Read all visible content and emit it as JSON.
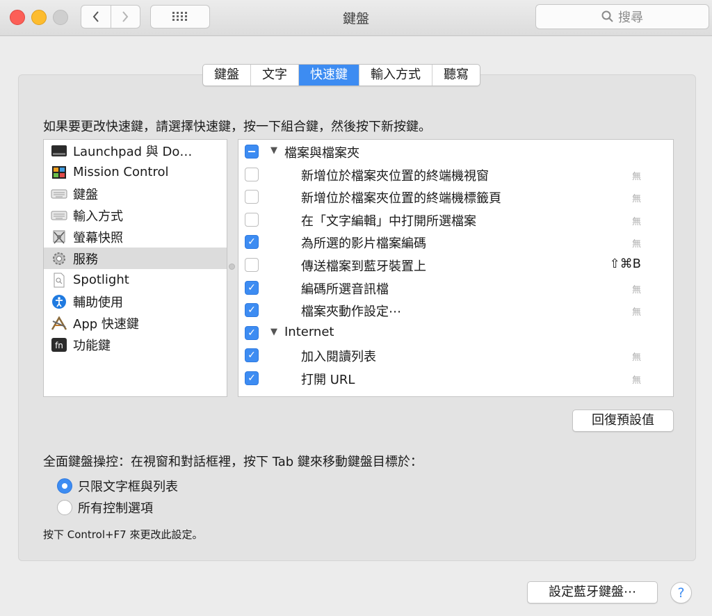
{
  "window": {
    "title": "鍵盤",
    "search_placeholder": "搜尋"
  },
  "tabs": [
    {
      "label": "鍵盤",
      "active": false
    },
    {
      "label": "文字",
      "active": false
    },
    {
      "label": "快速鍵",
      "active": true
    },
    {
      "label": "輸入方式",
      "active": false
    },
    {
      "label": "聽寫",
      "active": false
    }
  ],
  "instruction": "如果要更改快速鍵，請選擇快速鍵，按一下組合鍵，然後按下新按鍵。",
  "categories": [
    {
      "label": "Launchpad 與 Do…",
      "icon": "launchpad-icon",
      "selected": false
    },
    {
      "label": "Mission Control",
      "icon": "mission-control-icon",
      "selected": false
    },
    {
      "label": "鍵盤",
      "icon": "keyboard-icon",
      "selected": false
    },
    {
      "label": "輸入方式",
      "icon": "input-source-icon",
      "selected": false
    },
    {
      "label": "螢幕快照",
      "icon": "screenshot-icon",
      "selected": false
    },
    {
      "label": "服務",
      "icon": "services-gear-icon",
      "selected": true
    },
    {
      "label": "Spotlight",
      "icon": "spotlight-icon",
      "selected": false
    },
    {
      "label": "輔助使用",
      "icon": "accessibility-icon",
      "selected": false
    },
    {
      "label": "App 快速鍵",
      "icon": "app-shortcuts-icon",
      "selected": false
    },
    {
      "label": "功能鍵",
      "icon": "fn-key-icon",
      "selected": false
    }
  ],
  "shortcuts": [
    {
      "type": "group",
      "label": "檔案與檔案夾",
      "state": "mixed"
    },
    {
      "type": "item",
      "label": "新增位於檔案夾位置的終端機視窗",
      "state": "off",
      "shortcut": "無"
    },
    {
      "type": "item",
      "label": "新增位於檔案夾位置的終端機標籤頁",
      "state": "off",
      "shortcut": "無"
    },
    {
      "type": "item",
      "label": "在「文字編輯」中打開所選檔案",
      "state": "off",
      "shortcut": "無"
    },
    {
      "type": "item",
      "label": "為所選的影片檔案編碼",
      "state": "on",
      "shortcut": "無"
    },
    {
      "type": "item",
      "label": "傳送檔案到藍牙裝置上",
      "state": "off",
      "shortcut": "⇧⌘B"
    },
    {
      "type": "item",
      "label": "編碼所選音訊檔",
      "state": "on",
      "shortcut": "無"
    },
    {
      "type": "item",
      "label": "檔案夾動作設定⋯",
      "state": "on",
      "shortcut": "無"
    },
    {
      "type": "group",
      "label": "Internet",
      "state": "on"
    },
    {
      "type": "item",
      "label": "加入閱讀列表",
      "state": "on",
      "shortcut": "無"
    },
    {
      "type": "item",
      "label": "打開 URL",
      "state": "on",
      "shortcut": "無"
    }
  ],
  "reset_button": "回復預設值",
  "full_keyboard_access": {
    "label": "全面鍵盤操控：在視窗和對話框裡，按下 Tab 鍵來移動鍵盤目標於：",
    "options": [
      {
        "label": "只限文字框與列表",
        "selected": true
      },
      {
        "label": "所有控制選項",
        "selected": false
      }
    ],
    "hint": "按下 Control+F7 來更改此設定。"
  },
  "bluetooth_button": "設定藍牙鍵盤⋯",
  "help_label": "?",
  "colors": {
    "accent": "#3d8cf2",
    "close": "#fc5f57",
    "minimize": "#fdbc2e"
  }
}
